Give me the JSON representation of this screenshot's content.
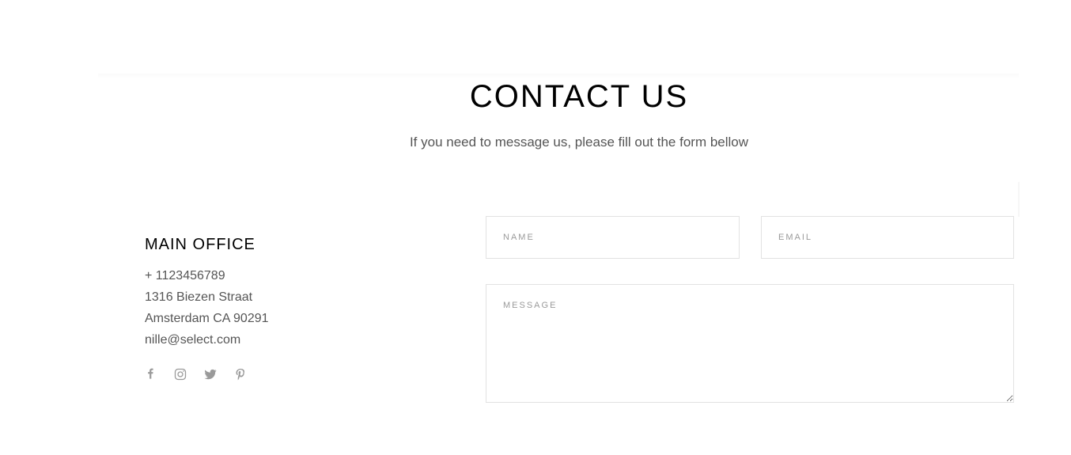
{
  "header": {
    "title": "CONTACT US",
    "subtitle": "If you need to message us, please fill out the form bellow"
  },
  "office": {
    "heading": "MAIN OFFICE",
    "phone": "+ 1123456789",
    "street": "1316 Biezen Straat",
    "city": "Amsterdam CA 90291",
    "email": "nille@select.com"
  },
  "social": [
    {
      "icon": "facebook-icon"
    },
    {
      "icon": "instagram-icon"
    },
    {
      "icon": "twitter-icon"
    },
    {
      "icon": "pinterest-icon"
    }
  ],
  "form": {
    "name_placeholder": "NAME",
    "email_placeholder": "EMAIL",
    "message_placeholder": "MESSAGE"
  },
  "colors": {
    "title": "#000000",
    "body_text": "#555555",
    "placeholder": "#9a9a9a",
    "field_border": "#e2e2e2"
  }
}
